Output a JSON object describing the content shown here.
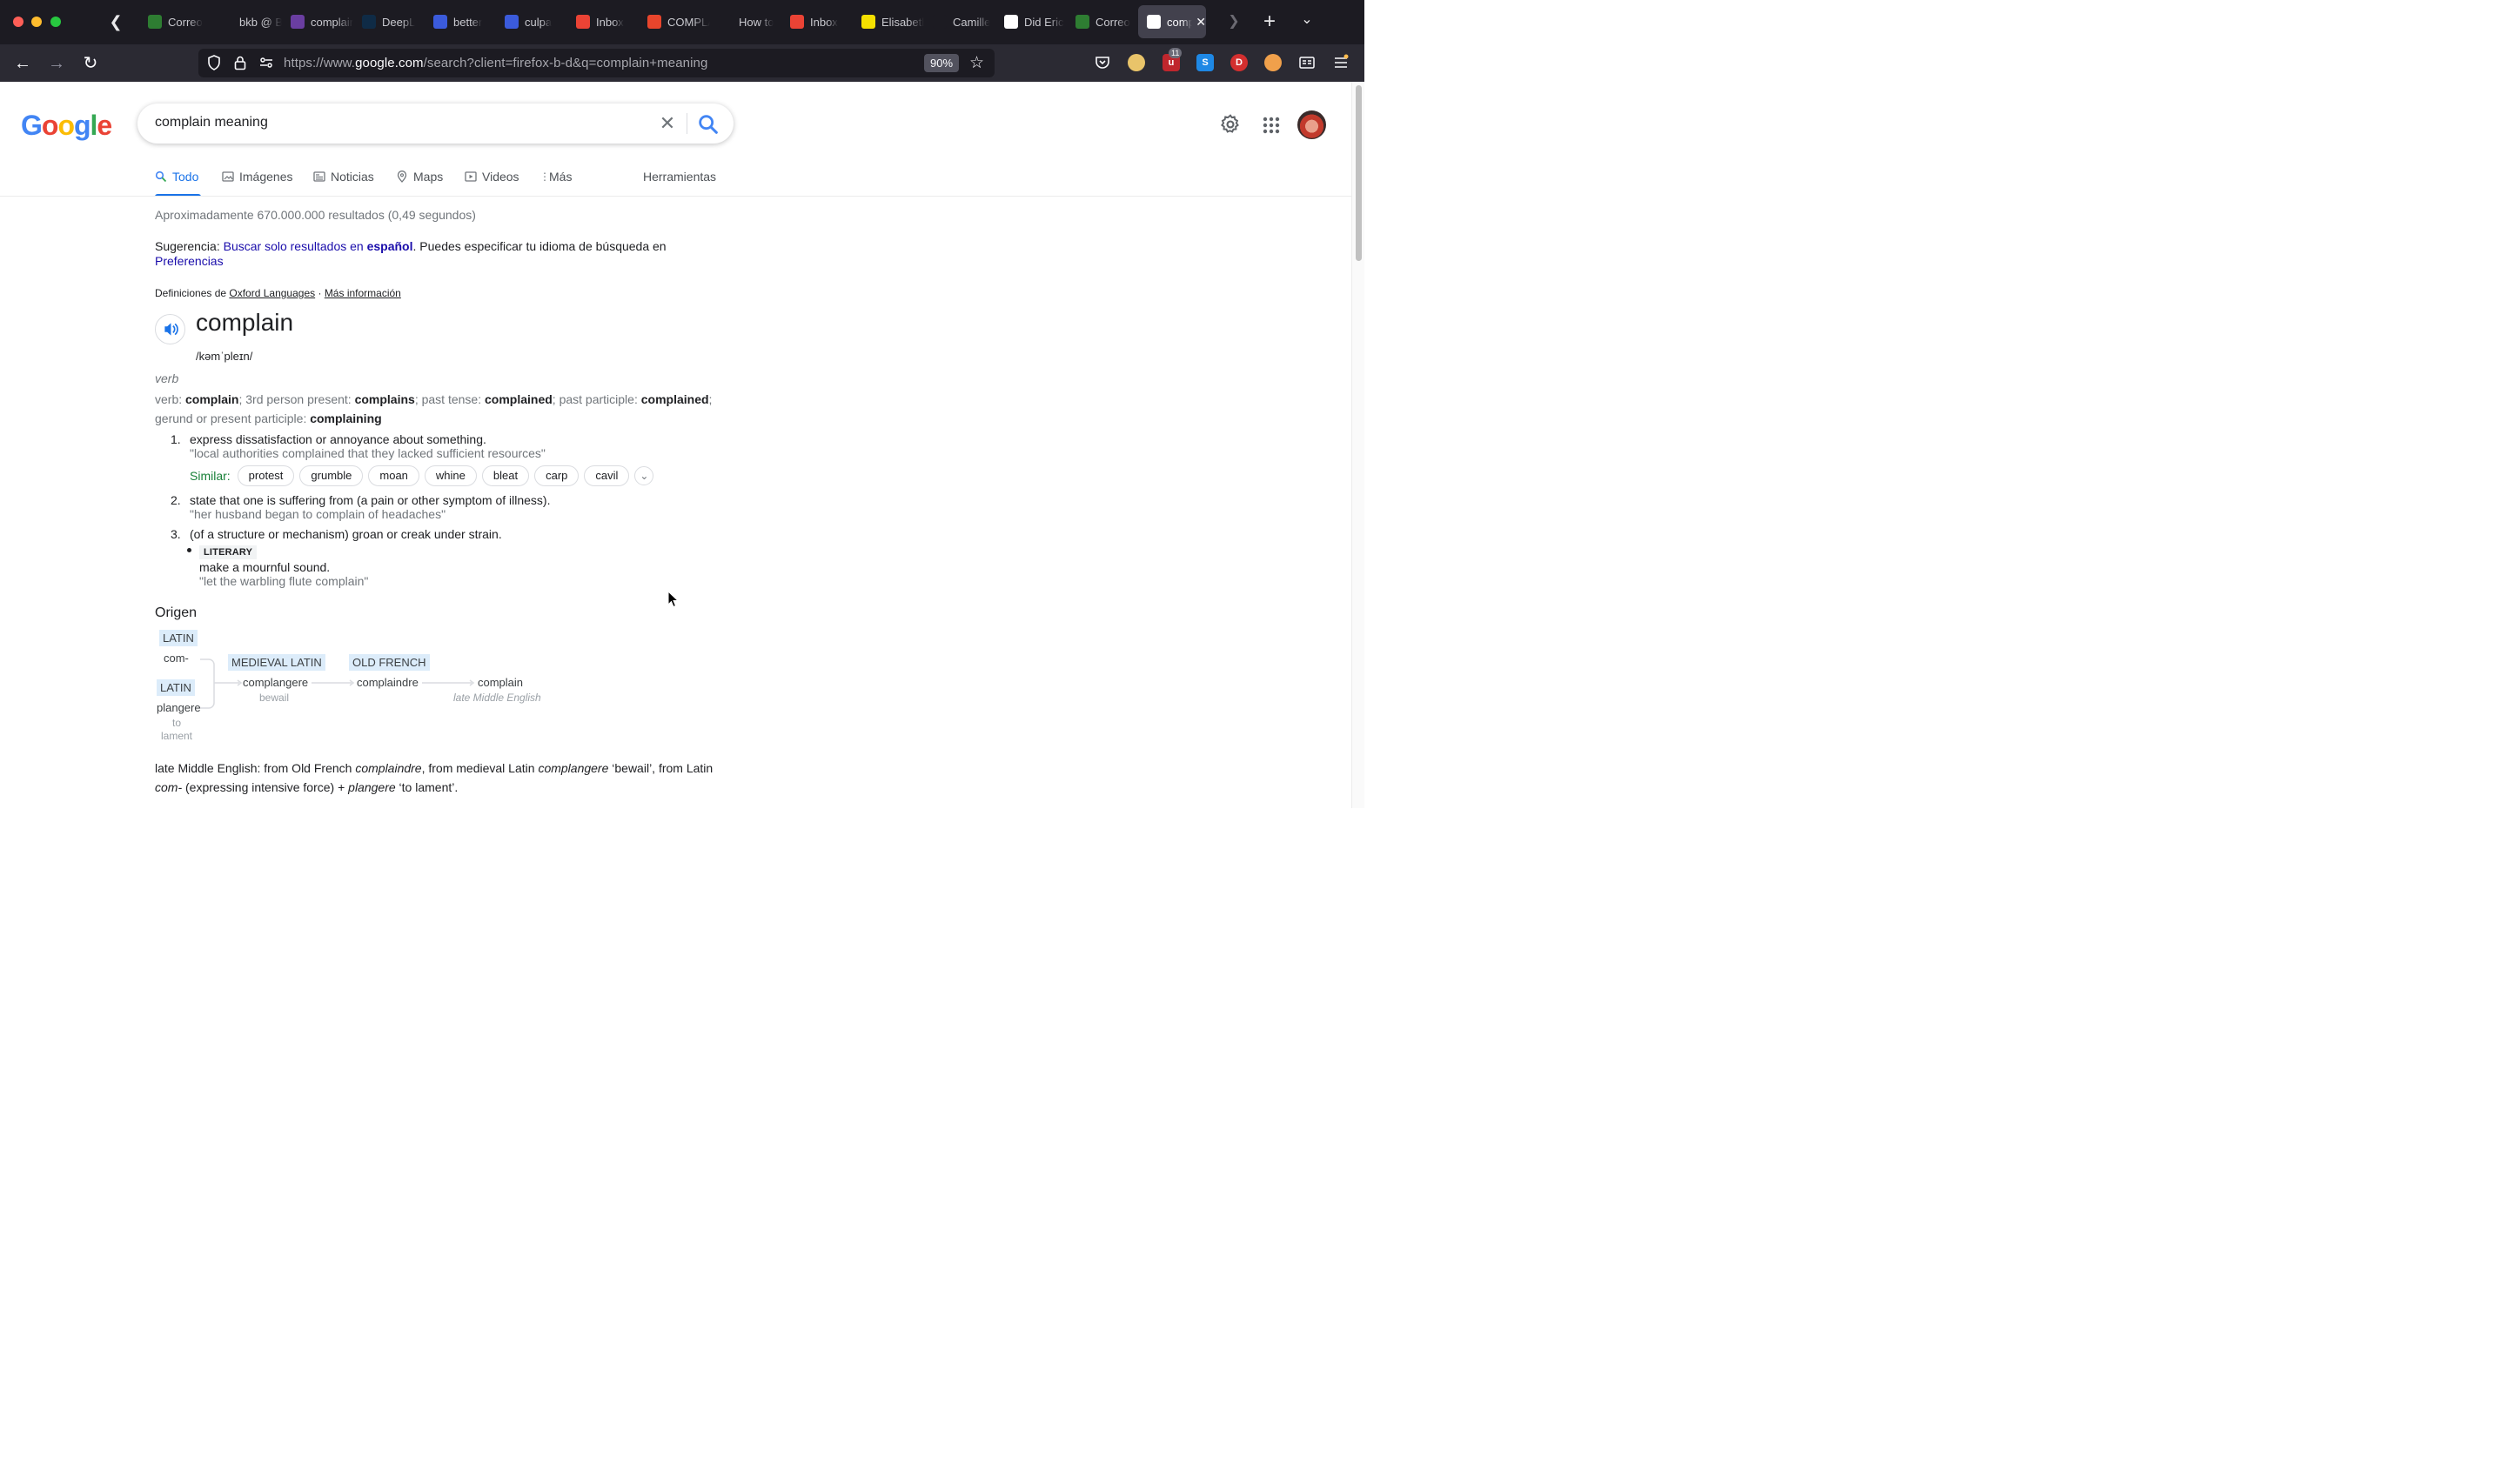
{
  "browser": {
    "tabs": [
      {
        "title": "Correo",
        "favicon": "green-grid-icon",
        "color": "#2e7d32"
      },
      {
        "title": "bkb @ Bau",
        "favicon": "none",
        "color": "#1c1b22"
      },
      {
        "title": "complain",
        "favicon": "purple-grid-icon",
        "color": "#6a3ea1"
      },
      {
        "title": "DeepL",
        "favicon": "deepl-icon",
        "color": "#0f2b46"
      },
      {
        "title": "better",
        "favicon": "r-icon",
        "color": "#3b5bdb"
      },
      {
        "title": "culpa",
        "favicon": "r-icon",
        "color": "#3b5bdb"
      },
      {
        "title": "Inbox",
        "favicon": "gmail-icon",
        "color": "#ea4335"
      },
      {
        "title": "COMPLAIN",
        "favicon": "t-icon",
        "color": "#e8452c"
      },
      {
        "title": "How to",
        "favicon": "mustache-icon",
        "color": "#1c1b22"
      },
      {
        "title": "Inbox",
        "favicon": "gmail-icon",
        "color": "#ea4335"
      },
      {
        "title": "Elisabeth",
        "favicon": "to-icon",
        "color": "#f5e000"
      },
      {
        "title": "Camille",
        "favicon": "circle-icon",
        "color": "#1c1b22"
      },
      {
        "title": "Did Eric",
        "favicon": "cut-icon",
        "color": "#ffffff"
      },
      {
        "title": "Correo",
        "favicon": "green-grid-icon",
        "color": "#2e7d32"
      },
      {
        "title": "complain meaning",
        "favicon": "google-g-icon",
        "color": "#ffffff",
        "active": true
      }
    ],
    "url_prefix": "https://www.",
    "url_domain": "google.com",
    "url_rest": "/search?client=firefox-b-d&q=complain+meaning",
    "zoom": "90%",
    "extension_badge": "11"
  },
  "google": {
    "logo": [
      "G",
      "o",
      "o",
      "g",
      "l",
      "e"
    ],
    "logo_colors": [
      "#4285f4",
      "#ea4335",
      "#fbbc05",
      "#4285f4",
      "#34a853",
      "#ea4335"
    ],
    "query": "complain meaning",
    "tabs": {
      "todo": "Todo",
      "images": "Imágenes",
      "news": "Noticias",
      "maps": "Maps",
      "videos": "Videos",
      "more": "Más",
      "tools": "Herramientas"
    },
    "result_stats": "Aproximadamente 670.000.000 resultados (0,49 segundos)",
    "suggestion": {
      "prefix": "Sugerencia: ",
      "link": "Buscar solo resultados en ",
      "link_bold": "español",
      "suffix": ". Puedes especificar tu idioma de búsqueda en ",
      "prefs_link": "Preferencias"
    }
  },
  "dictionary": {
    "source_prefix": "Definiciones de ",
    "source_name": "Oxford Languages",
    "source_sep": " · ",
    "more_info": "Más información",
    "word": "complain",
    "phonetic": "/kəmˈpleɪn/",
    "pos": "verb",
    "inflections": {
      "verb_label": "verb",
      "base": "complain",
      "third_label": "3rd person present",
      "third": "complains",
      "past_label": "past tense",
      "past": "complained",
      "pp_label": "past participle",
      "pp": "complained",
      "ger_label": "gerund or present participle",
      "ger": "complaining"
    },
    "senses": [
      {
        "num": "1.",
        "def": "express dissatisfaction or annoyance about something.",
        "example": "\"local authorities complained that they lacked sufficient resources\""
      },
      {
        "num": "2.",
        "def": "state that one is suffering from (a pain or other symptom of illness).",
        "example": "\"her husband began to complain of headaches\""
      },
      {
        "num": "3.",
        "def": "(of a structure or mechanism) groan or creak under strain."
      }
    ],
    "similar_label": "Similar:",
    "similar": [
      "protest",
      "grumble",
      "moan",
      "whine",
      "bleat",
      "carp",
      "cavil"
    ],
    "literary": {
      "tag": "LITERARY",
      "def": "make a mournful sound.",
      "example": "\"let the warbling flute complain\""
    },
    "origin_heading": "Origen",
    "etymology": {
      "latin1_tag": "LATIN",
      "latin1_word": "com-",
      "latin2_tag": "LATIN",
      "latin2_word": "plangere",
      "latin2_gloss1": "to",
      "latin2_gloss2": "lament",
      "medieval_tag": "MEDIEVAL LATIN",
      "medieval_word": "complangere",
      "medieval_gloss": "bewail",
      "french_tag": "OLD FRENCH",
      "french_word": "complaindre",
      "final_word": "complain",
      "final_era": "late Middle English"
    },
    "origin_summary": {
      "p1": "late Middle English: from Old French ",
      "i1": "complaindre",
      "p2": ", from medieval Latin ",
      "i2": "complangere",
      "p3": " ‘bewail’, from Latin ",
      "i3": "com-",
      "p4": " (expressing intensive force) + ",
      "i4": "plangere",
      "p5": " ‘to lament’."
    }
  }
}
